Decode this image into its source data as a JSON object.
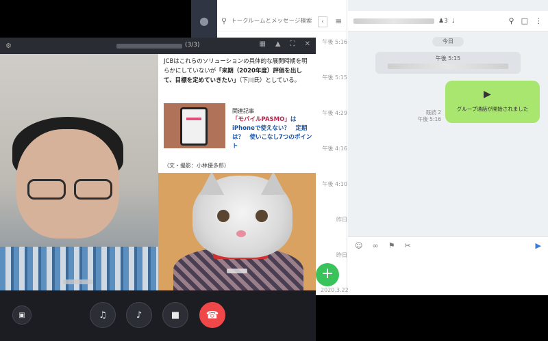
{
  "line": {
    "window_controls": [
      "—",
      "□",
      "✕"
    ],
    "search": {
      "placeholder": "トークルームとメッセージ検索"
    },
    "list_times": [
      "午後 5:16",
      "午後 5:15",
      "午後 4:29",
      "午後 4:16",
      "午後 4:10",
      "昨日",
      "昨日"
    ],
    "chat": {
      "member_count": "3",
      "date_pill": "今日",
      "sys_time": "午後 5:15",
      "bubble_text": "グループ通話が開始されました",
      "read_status": "既読 2",
      "bubble_time": "午後 5:16"
    }
  },
  "call": {
    "participant_count": "(3/3)",
    "article": {
      "paragraph_lead": "JCBはこれらのソリューションの具体的な展開時期を明らかにしていないが",
      "paragraph_bold": "「来期（2020年度）評価を出して、目標を定めていきたい」",
      "paragraph_tail": "（下川氏）としている。",
      "related_label": "関連記事",
      "link_red": "「モバイルPASMO」",
      "link_rest": "はiPhoneで使えない？　定期は？　使いこなし7つのポイント",
      "credit": "（文・撮影：小林優多郎）"
    },
    "fab_label": "+",
    "date_below": "2020.3.22"
  },
  "icons": {
    "gear": "gear-icon",
    "mic_off": "mic-off-icon",
    "speaker_off": "speaker-off-icon",
    "camera": "camera-icon",
    "end_call": "end-call-icon"
  },
  "colors": {
    "line_green": "#3ac25b",
    "bubble_green": "#a9e66f",
    "end_call_red": "#f04848",
    "rail_dark": "#2f3542"
  }
}
